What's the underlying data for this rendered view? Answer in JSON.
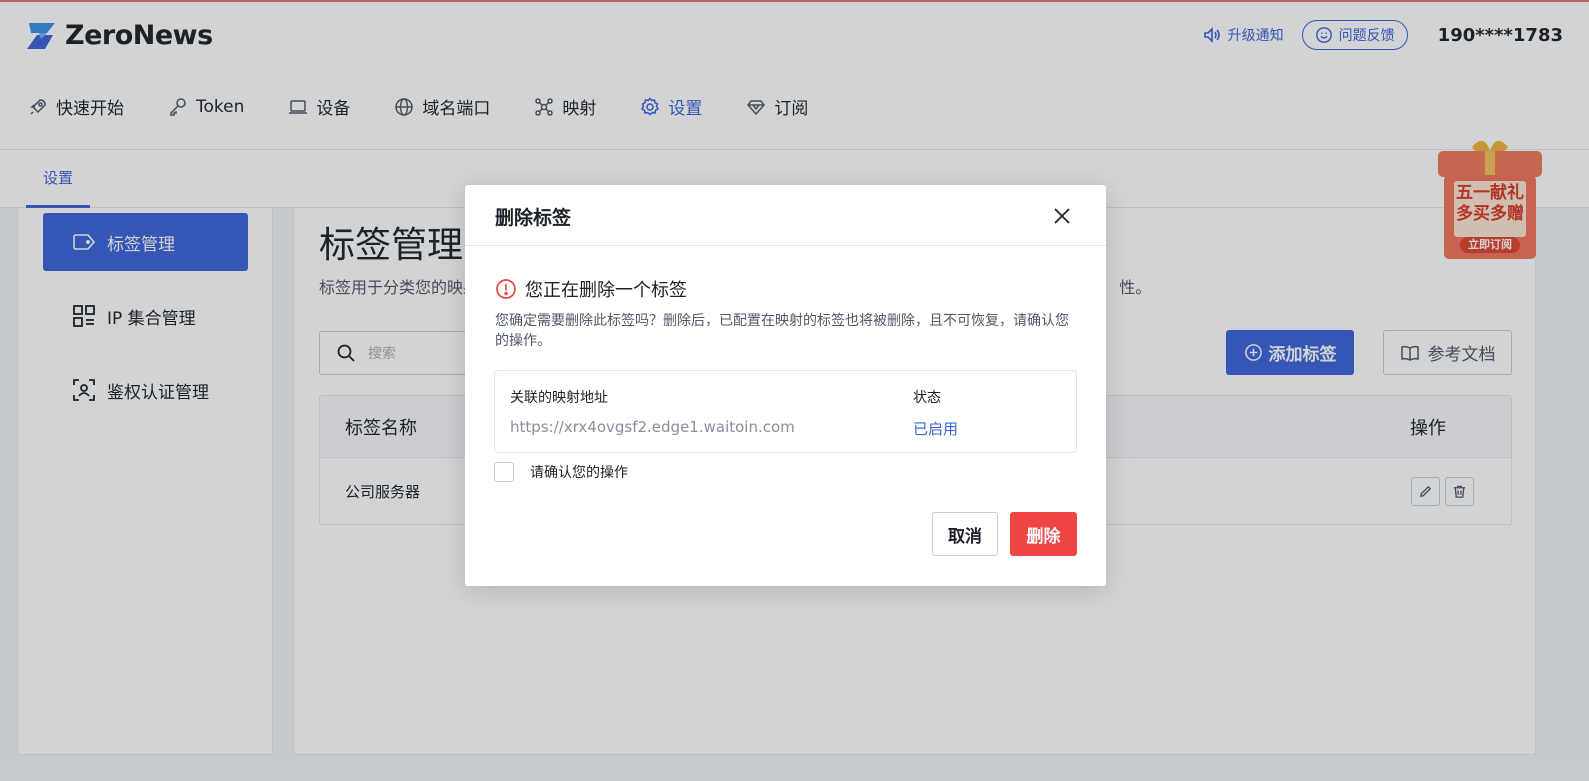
{
  "app": {
    "brand": "ZeroNews"
  },
  "header": {
    "upgrade_notice": "升级通知",
    "feedback": "问题反馈",
    "user_phone": "190****1783"
  },
  "nav": {
    "items": [
      {
        "label": "快速开始",
        "icon": "rocket-icon"
      },
      {
        "label": "Token",
        "icon": "key-icon"
      },
      {
        "label": "设备",
        "icon": "laptop-icon"
      },
      {
        "label": "域名端口",
        "icon": "globe-icon"
      },
      {
        "label": "映射",
        "icon": "network-icon"
      },
      {
        "label": "设置",
        "icon": "gear-icon",
        "active": true
      },
      {
        "label": "订阅",
        "icon": "diamond-icon"
      }
    ]
  },
  "subtabs": {
    "settings": "设置"
  },
  "sidebar": {
    "items": [
      {
        "label": "标签管理",
        "icon": "tag-icon",
        "active": true
      },
      {
        "label": "IP 集合管理",
        "icon": "grid-icon"
      },
      {
        "label": "鉴权认证管理",
        "icon": "user-scan-icon"
      }
    ]
  },
  "main": {
    "title": "标签管理",
    "description": "标签用于分类您的映射",
    "description_tail": "性。",
    "search_placeholder": "搜索",
    "add_button": "添加标签",
    "docs_button": "参考文档",
    "table": {
      "col_name": "标签名称",
      "col_actions": "操作",
      "rows": [
        {
          "name": "公司服务器"
        }
      ]
    }
  },
  "promo": {
    "line1": "五一献礼",
    "line2": "多买多赠",
    "cta": "立即订阅"
  },
  "modal": {
    "title": "删除标签",
    "warning": "您正在删除一个标签",
    "description": "您确定需要删除此标签吗？删除后，已配置在映射的标签也将被删除，且不可恢复，请确认您的操作。",
    "col_address": "关联的映射地址",
    "col_status": "状态",
    "address": "https://xrx4ovgsf2.edge1.waitoin.com",
    "status": "已启用",
    "confirm_label": "请确认您的操作",
    "cancel": "取消",
    "delete": "删除"
  },
  "colors": {
    "accent": "#3b63d9",
    "danger": "#f04545"
  }
}
